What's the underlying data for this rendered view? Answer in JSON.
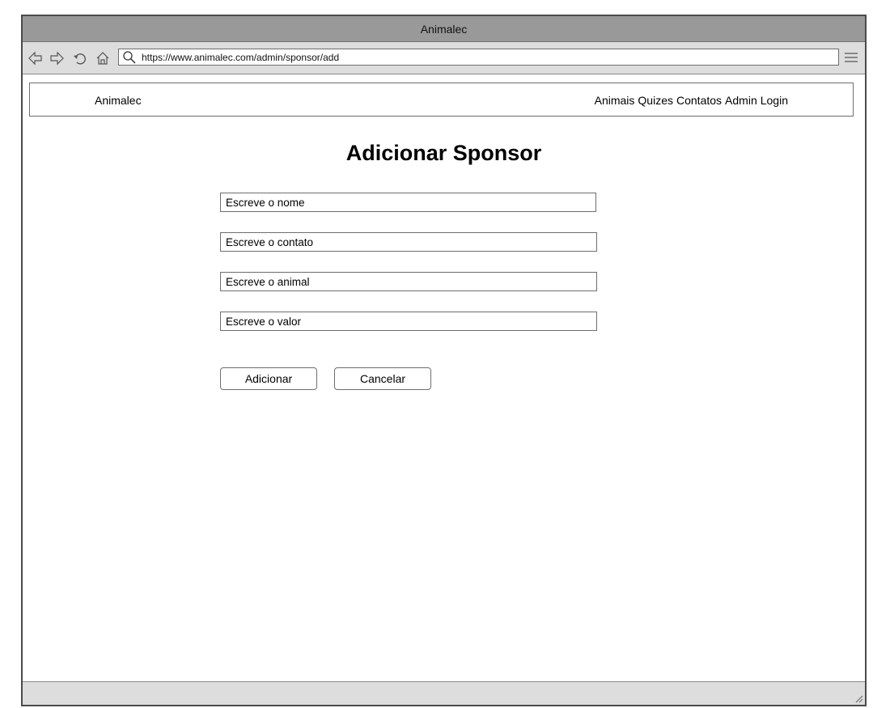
{
  "window": {
    "title": "Animalec"
  },
  "browser": {
    "url": "https://www.animalec.com/admin/sponsor/add",
    "icons": [
      "back-icon",
      "forward-icon",
      "reload-icon",
      "home-icon",
      "search-icon",
      "menu-icon",
      "resize-grip-icon"
    ]
  },
  "navbar": {
    "brand": "Animalec",
    "links": [
      "Animais",
      "Quizes",
      "Contatos",
      "Admin",
      "Login"
    ]
  },
  "form": {
    "title": "Adicionar Sponsor",
    "fields": [
      {
        "placeholder": "Escreve o nome"
      },
      {
        "placeholder": "Escreve o contato"
      },
      {
        "placeholder": "Escreve o animal"
      },
      {
        "placeholder": "Escreve o valor"
      }
    ],
    "submit_label": "Adicionar",
    "cancel_label": "Cancelar"
  }
}
